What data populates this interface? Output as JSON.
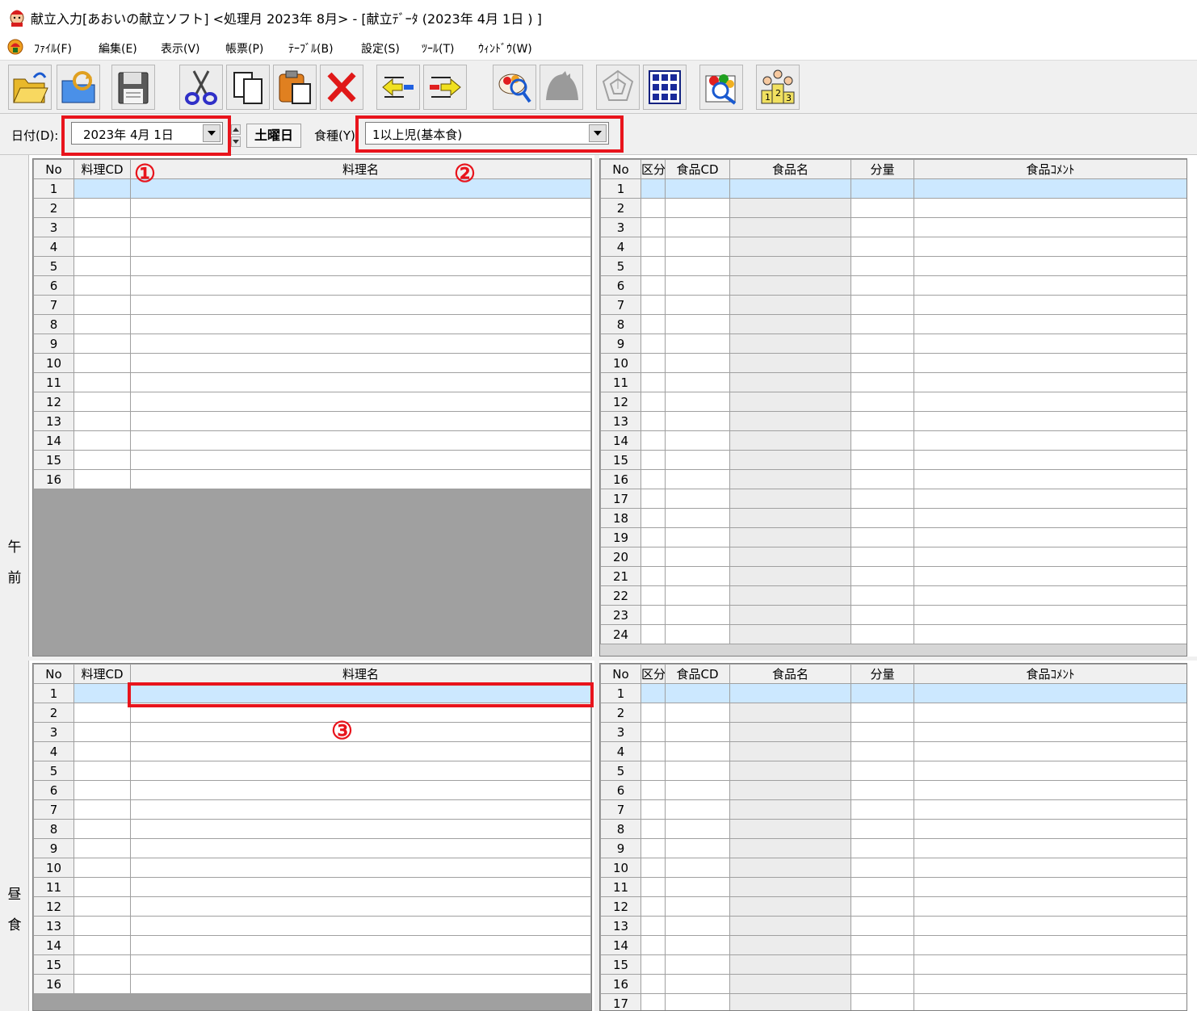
{
  "window": {
    "title": "献立入力[あおいの献立ソフト] <処理月 2023年 8月> - [献立ﾃﾞｰﾀ (2023年 4月 1日 ) ]"
  },
  "menu": [
    "ﾌｧｲﾙ(F)",
    "編集(E)",
    "表示(V)",
    "帳票(P)",
    "ﾃｰﾌﾞﾙ(B)",
    "設定(S)",
    "ﾂｰﾙ(T)",
    "ｳｨﾝﾄﾞｳ(W)"
  ],
  "toolbar": [
    "open-folder-icon",
    "reload-folder-icon",
    "save-disk-icon",
    "cut-scissors-icon",
    "copy-pages-icon",
    "paste-icon",
    "delete-x-icon",
    "import-arrow-icon",
    "export-arrow-icon",
    "food-search-icon",
    "nutrition-disabled-icon",
    "radar-chart-disabled-icon",
    "grid-calendar-icon",
    "food-check-icon",
    "ranking-users-icon"
  ],
  "filter": {
    "date_label": "日付(D):",
    "date_value": "2023年 4月 1日",
    "weekday": "土曜日",
    "food_type_label": "食種(Y):",
    "food_type_value": "1以上児(基本食)"
  },
  "annotations": {
    "a1": "①",
    "a2": "②",
    "a3": "③",
    "color": "#e8141c"
  },
  "sections": {
    "morning": {
      "label1": "午",
      "label2": "前"
    },
    "lunch": {
      "label1": "昼",
      "label2": "食"
    }
  },
  "dish_grid": {
    "headers": [
      "No",
      "料理CD",
      "料理名"
    ]
  },
  "food_grid": {
    "headers": [
      "No",
      "区分",
      "食品CD",
      "食品名",
      "分量",
      "食品ｺﾒﾝﾄ"
    ]
  },
  "rows": {
    "morning_dish": [
      "1",
      "2",
      "3",
      "4",
      "5",
      "6",
      "7",
      "8",
      "9",
      "10",
      "11",
      "12",
      "13",
      "14",
      "15",
      "16"
    ],
    "morning_food": [
      "1",
      "2",
      "3",
      "4",
      "5",
      "6",
      "7",
      "8",
      "9",
      "10",
      "11",
      "12",
      "13",
      "14",
      "15",
      "16",
      "17",
      "18",
      "19",
      "20",
      "21",
      "22",
      "23",
      "24"
    ],
    "lunch_dish": [
      "1",
      "2",
      "3",
      "4",
      "5",
      "6",
      "7",
      "8",
      "9",
      "10",
      "11",
      "12",
      "13",
      "14",
      "15",
      "16"
    ],
    "lunch_food": [
      "1",
      "2",
      "3",
      "4",
      "5",
      "6",
      "7",
      "8",
      "9",
      "10",
      "11",
      "12",
      "13",
      "14",
      "15",
      "16",
      "17"
    ]
  },
  "colors": {
    "selected_row": "#cce8ff",
    "header_bg": "#f0f0f0",
    "grid_empty": "#a0a0a0"
  }
}
